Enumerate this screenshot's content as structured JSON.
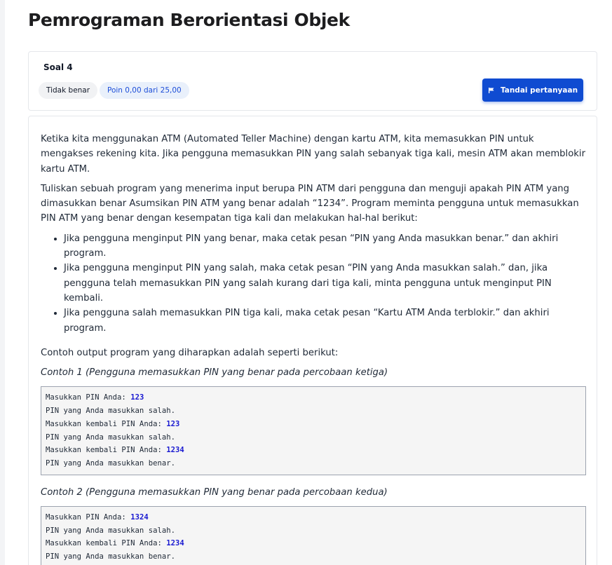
{
  "page": {
    "course_title": "Pemrograman Berorientasi Objek"
  },
  "question": {
    "number_label": "Soal 4",
    "status_label": "Tidak benar",
    "points_label": "Poin 0,00 dari 25,00",
    "flag_button_label": "Tandai pertanyaan"
  },
  "content": {
    "paragraph_1": "Ketika kita menggunakan ATM (Automated Teller Machine) dengan kartu ATM, kita memasukkan PIN untuk mengakses rekening kita. Jika pengguna memasukkan PIN yang salah sebanyak tiga kali, mesin ATM akan memblokir kartu ATM.",
    "paragraph_2": "Tuliskan sebuah program yang menerima input berupa PIN ATM dari pengguna dan menguji apakah PIN ATM yang dimasukkan benar Asumsikan PIN ATM yang benar adalah “1234”.  Program meminta pengguna untuk memasukkan PIN ATM yang benar dengan kesempatan tiga kali dan melakukan hal-hal berikut:",
    "bullets": [
      "Jika pengguna menginput PIN yang benar, maka cetak pesan “PIN yang Anda masukkan benar.” dan akhiri program.",
      "Jika pengguna menginput PIN yang salah, maka cetak pesan “PIN yang Anda masukkan salah.” dan, jika pengguna telah memasukkan PIN yang salah kurang dari tiga kali, minta pengguna untuk menginput PIN kembali.",
      "Jika pengguna salah memasukkan PIN tiga kali, maka cetak pesan “Kartu ATM Anda terblokir.” dan akhiri program."
    ],
    "output_intro": "Contoh output program yang diharapkan adalah seperti berikut:",
    "example_1_label": "Contoh 1 (Pengguna memasukkan PIN yang benar pada percobaan ketiga)",
    "example_1_lines": [
      {
        "prompt": "Masukkan PIN Anda: ",
        "input": "123"
      },
      {
        "prompt": "PIN yang Anda masukkan salah.",
        "input": ""
      },
      {
        "prompt": "Masukkan kembali PIN Anda: ",
        "input": "123"
      },
      {
        "prompt": "PIN yang Anda masukkan salah.",
        "input": ""
      },
      {
        "prompt": "Masukkan kembali PIN Anda: ",
        "input": "1234"
      },
      {
        "prompt": "PIN yang Anda masukkan benar.",
        "input": ""
      }
    ],
    "example_2_label": "Contoh 2 (Pengguna memasukkan PIN yang benar pada percobaan kedua)",
    "example_2_lines": [
      {
        "prompt": "Masukkan PIN Anda: ",
        "input": "1324"
      },
      {
        "prompt": "PIN yang Anda masukkan salah.",
        "input": ""
      },
      {
        "prompt": "Masukkan kembali PIN Anda: ",
        "input": "1234"
      },
      {
        "prompt": "PIN yang Anda masukkan benar.",
        "input": ""
      }
    ]
  },
  "colors": {
    "accent": "#0f4bd1",
    "code_input": "#1a1ad1"
  },
  "icons": {
    "flag": "flag-icon"
  }
}
